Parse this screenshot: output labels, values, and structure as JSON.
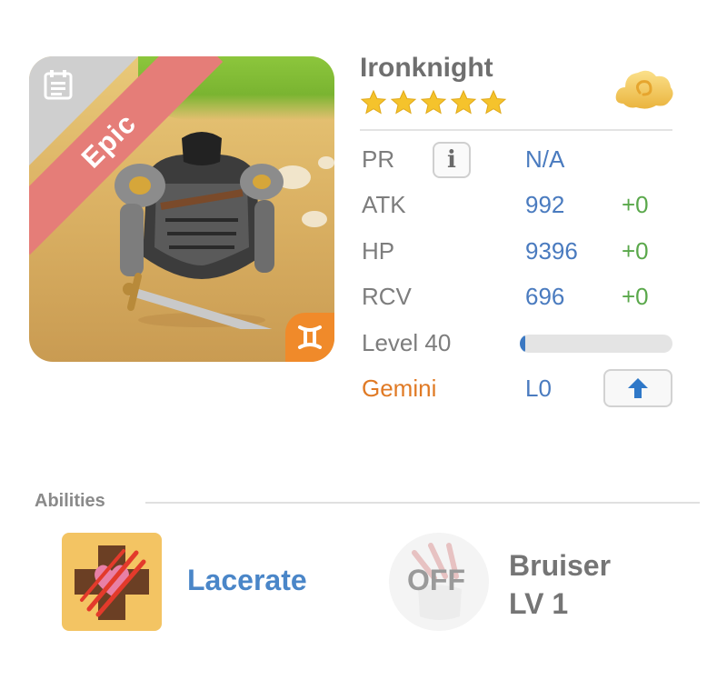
{
  "hero": {
    "rarity": "Epic",
    "name": "Ironknight",
    "stars": 5,
    "zodiac_icon": "gemini-icon",
    "element_icon": "cloud-icon"
  },
  "stats": {
    "pr": {
      "label": "PR",
      "value": "N/A"
    },
    "atk": {
      "label": "ATK",
      "value": "992",
      "bonus": "+0"
    },
    "hp": {
      "label": "HP",
      "value": "9396",
      "bonus": "+0"
    },
    "rcv": {
      "label": "RCV",
      "value": "696",
      "bonus": "+0"
    },
    "level": {
      "label": "Level 40",
      "progress": 0.02
    },
    "zodiac": {
      "label": "Gemini",
      "value": "L0"
    }
  },
  "abilities": {
    "title": "Abilities",
    "active": {
      "name": "Lacerate"
    },
    "passive": {
      "status": "OFF",
      "name": "Bruiser",
      "level": "LV 1"
    }
  },
  "colors": {
    "rarity_ribbon": "#e57d78",
    "stat_value": "#4a7bbf",
    "stat_bonus": "#5aa84b",
    "zodiac_label": "#e07a25"
  }
}
